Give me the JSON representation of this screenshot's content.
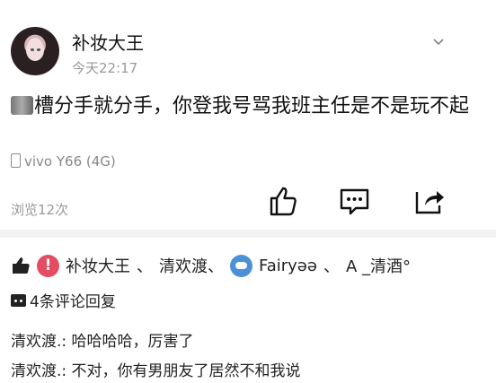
{
  "post": {
    "author": "补妆大王",
    "time": "今天22:17",
    "content_after_blur": "槽分手就分手，你登我号骂我班主任是不是玩不起",
    "device": "vivo Y66 (4G)",
    "views": "浏览12次"
  },
  "icons": {
    "more": "chevron-down-icon",
    "like": "thumbs-up-icon",
    "comment": "comment-icon",
    "share": "share-icon"
  },
  "likes": {
    "users": [
      "补妆大王",
      "清欢渡、",
      "Fairyəə",
      "A _清酒°"
    ],
    "separators": [
      "、"
    ]
  },
  "comments": {
    "header": "4条评论回复",
    "items": [
      {
        "user": "清欢渡.:",
        "text": " 哈哈哈哈，厉害了"
      },
      {
        "user": "清欢渡.:",
        "text": " 不对，你有男朋友了居然不和我说"
      }
    ]
  }
}
